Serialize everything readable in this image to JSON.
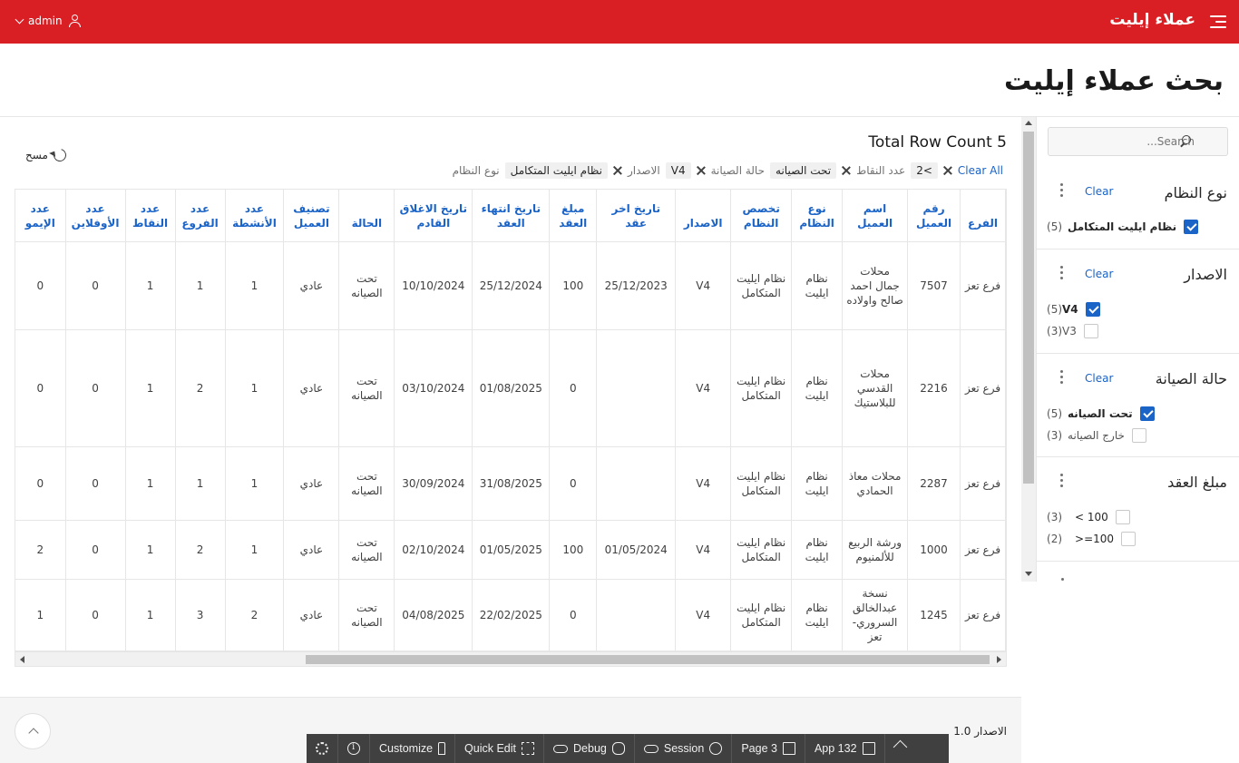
{
  "header": {
    "app_title": "عملاء إيليت",
    "user_name": "admin"
  },
  "page_title": "بحث عملاء إيليت",
  "search": {
    "placeholder": "Search..."
  },
  "facets": [
    {
      "title": "نوع النظام",
      "clear": "Clear",
      "options": [
        {
          "label": "نظام ايليت المتكامل",
          "count": "(5)",
          "checked": true
        }
      ]
    },
    {
      "title": "الاصدار",
      "clear": "Clear",
      "options": [
        {
          "label": "V4",
          "count": "(5)",
          "checked": true
        },
        {
          "label": "V3",
          "count": "(3)",
          "checked": false
        }
      ]
    },
    {
      "title": "حالة الصيانة",
      "clear": "Clear",
      "options": [
        {
          "label": "تحت الصيانه",
          "count": "(5)",
          "checked": true
        },
        {
          "label": "خارج الصيانه",
          "count": "(3)",
          "checked": false
        }
      ]
    },
    {
      "title": "مبلغ العقد",
      "options": [
        {
          "label": "100 >",
          "count": "(3)",
          "checked": false
        },
        {
          "label": "100=<",
          "count": "(2)",
          "checked": false
        }
      ]
    }
  ],
  "report": {
    "row_count": "Total Row Count 5",
    "reset_label": "مسح",
    "filters": [
      {
        "label": "نوع النظام",
        "value": "نظام ايليت المتكامل"
      },
      {
        "label": "الاصدار",
        "value": "V4"
      },
      {
        "label": "حالة الصيانة",
        "value": "تحت الصيانه"
      },
      {
        "label": "عدد النقاط",
        "value": ">2"
      }
    ],
    "clear_all": "Clear All"
  },
  "table": {
    "columns": [
      "الفرع",
      "رقم العميل",
      "اسم العميل",
      "نوع النظام",
      "تخصص النظام",
      "الاصدار",
      "تاريخ اخر عقد",
      "مبلغ العقد",
      "تاريخ انتهاء العقد",
      "تاريخ الاغلاق القادم",
      "الحالة",
      "تصنيف العميل",
      "عدد الأنشطة",
      "عدد الفروع",
      "عدد النقاط",
      "عدد الأوفلاين",
      "عدد الإيمو"
    ],
    "rows": [
      [
        "فرع تعز",
        "7507",
        "محلات جمال احمد صالح واولاده",
        "نظام ايليت",
        "نظام ايليت المتكامل",
        "V4",
        "25/12/2023",
        "100",
        "25/12/2024",
        "10/10/2024",
        "تحت الصيانه",
        "عادي",
        "1",
        "1",
        "1",
        "0",
        "0"
      ],
      [
        "فرع تعز",
        "2216",
        "محلات القدسي للبلاستيك",
        "نظام ايليت",
        "نظام ايليت المتكامل",
        "V4",
        "",
        "0",
        "01/08/2025",
        "03/10/2024",
        "تحت الصيانه",
        "عادي",
        "1",
        "2",
        "1",
        "0",
        "0"
      ],
      [
        "فرع تعز",
        "2287",
        "محلات معاذ الحمادي",
        "نظام ايليت",
        "نظام ايليت المتكامل",
        "V4",
        "",
        "0",
        "31/08/2025",
        "30/09/2024",
        "تحت الصيانه",
        "عادي",
        "1",
        "1",
        "1",
        "0",
        "0"
      ],
      [
        "فرع تعز",
        "1000",
        "ورشة الربيع للألمنيوم",
        "نظام ايليت",
        "نظام ايليت المتكامل",
        "V4",
        "01/05/2024",
        "100",
        "01/05/2025",
        "02/10/2024",
        "تحت الصيانه",
        "عادي",
        "1",
        "2",
        "1",
        "0",
        "2"
      ],
      [
        "فرع تعز",
        "1245",
        "نسخة عبدالخالق السروري- تعز",
        "نظام ايليت",
        "نظام ايليت المتكامل",
        "V4",
        "",
        "0",
        "22/02/2025",
        "04/08/2025",
        "تحت الصيانه",
        "عادي",
        "2",
        "3",
        "1",
        "0",
        "1"
      ]
    ]
  },
  "footer": {
    "version": "الاصدار 1.0"
  },
  "devbar": {
    "app": "App 132",
    "page": "Page 3",
    "session": "Session",
    "debug": "Debug",
    "quick_edit": "Quick Edit",
    "customize": "Customize"
  }
}
